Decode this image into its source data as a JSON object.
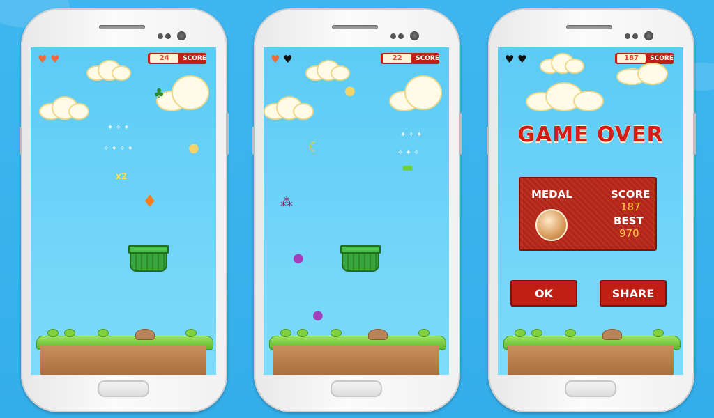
{
  "colors": {
    "background": "#3fb6f0",
    "screen_sky": "#5ccbf5",
    "accent_red": "#c21f14",
    "score_text": "#e0462b",
    "heart_full": "#ef6b3a",
    "heart_empty": "#111111",
    "basket_green": "#3aa53a"
  },
  "phones": [
    {
      "hearts": [
        "full",
        "full"
      ],
      "score": "24",
      "score_label": "SCORE",
      "basket_bonus": "x2",
      "items": [
        "broccoli-icon",
        "mushroom-icon",
        "carrot-icon"
      ]
    },
    {
      "hearts": [
        "full",
        "empty"
      ],
      "score": "22",
      "score_label": "SCORE",
      "items": [
        "banana-icon",
        "grapes-icon",
        "mushroom-icon",
        "eggplant-icon",
        "eggplant-icon"
      ]
    },
    {
      "hearts": [
        "empty",
        "empty"
      ],
      "score": "187",
      "score_label": "SCORE",
      "game_over": {
        "title": "GAME OVER",
        "medal_label": "MEDAL",
        "score_label": "SCORE",
        "score_value": "187",
        "best_label": "BEST",
        "best_value": "970",
        "ok_label": "OK",
        "share_label": "SHARE"
      }
    }
  ]
}
